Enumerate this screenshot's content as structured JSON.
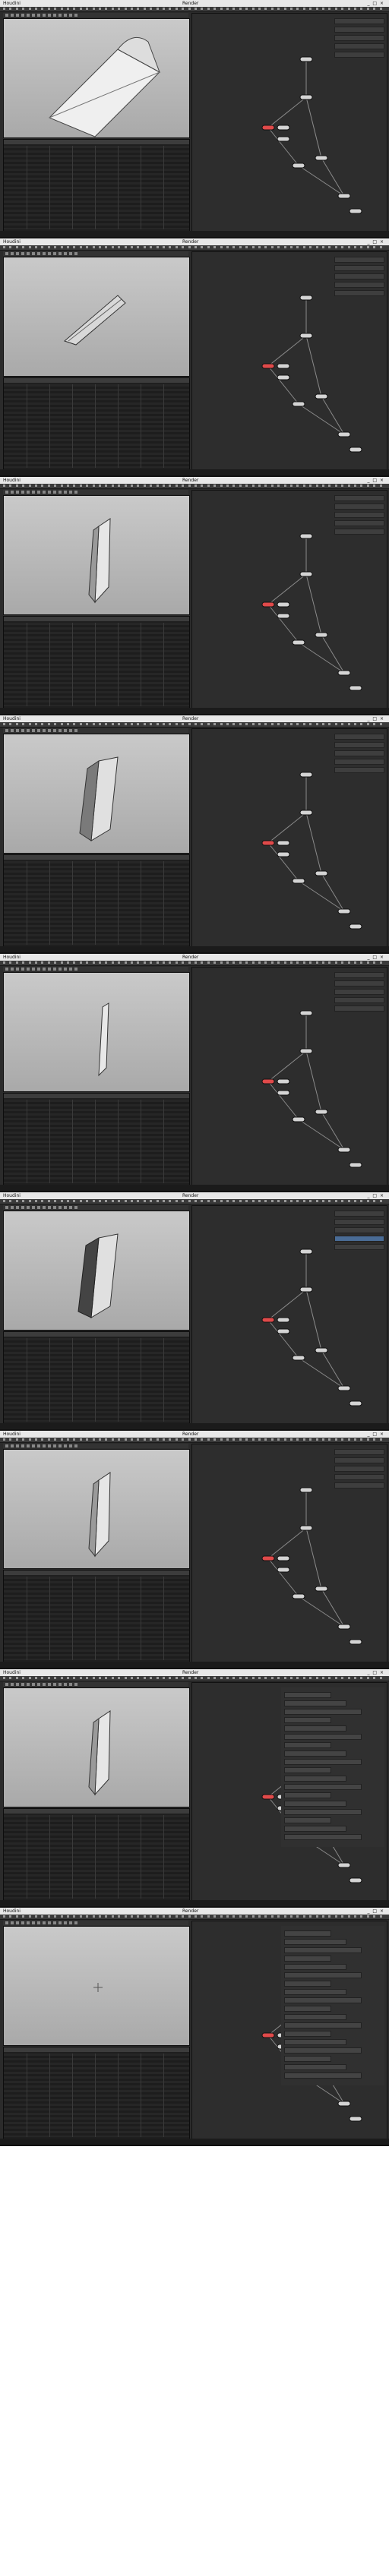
{
  "frames": [
    {
      "title": "Houdini",
      "subtitle": "Render",
      "status": "",
      "shape": "vase_close",
      "variant": "default"
    },
    {
      "title": "Houdini",
      "subtitle": "Render",
      "status": "",
      "shape": "blade_flat",
      "variant": "default"
    },
    {
      "title": "Houdini",
      "subtitle": "Render",
      "status": "",
      "shape": "blade_up",
      "variant": "default"
    },
    {
      "title": "Houdini",
      "subtitle": "Render",
      "status": "",
      "shape": "blade_thick",
      "variant": "default"
    },
    {
      "title": "Houdini",
      "subtitle": "Render",
      "status": "",
      "shape": "blade_thin",
      "variant": "default"
    },
    {
      "title": "Houdini",
      "subtitle": "Render",
      "status": "",
      "shape": "blade_dark",
      "variant": "highlight"
    },
    {
      "title": "Houdini",
      "subtitle": "Render",
      "status": "",
      "shape": "blade_up",
      "variant": "default"
    },
    {
      "title": "Houdini",
      "subtitle": "Render",
      "status": "",
      "shape": "blade_up",
      "variant": "params"
    },
    {
      "title": "Houdini",
      "subtitle": "Render",
      "status": "",
      "shape": "empty",
      "variant": "params"
    }
  ],
  "colors": {
    "bg": "#2b2b2b",
    "node": "#d4d4d4",
    "node_selected": "#e04a4a",
    "wire": "#8a8a8a",
    "highlight": "#4a6c96"
  }
}
